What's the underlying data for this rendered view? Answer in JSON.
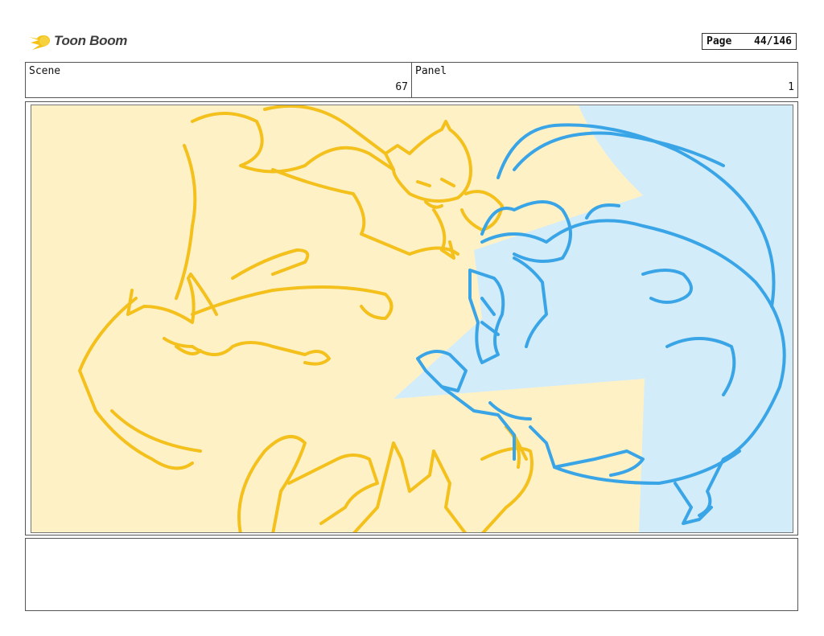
{
  "header": {
    "logo_text": "Toon Boom",
    "page_label": "Page",
    "page_value": "44/146"
  },
  "info": {
    "scene_label": "Scene",
    "scene_value": "67",
    "panel_label": "Panel",
    "panel_value": "1"
  },
  "panel": {
    "image_name": "storyboard-sketch",
    "colors": {
      "background_yellow": "#fff1c6",
      "background_blue": "#d2ecfa",
      "cat_lines": "#f3c01c",
      "rat_lines": "#3aa5e6"
    }
  },
  "notes": {
    "text": ""
  }
}
